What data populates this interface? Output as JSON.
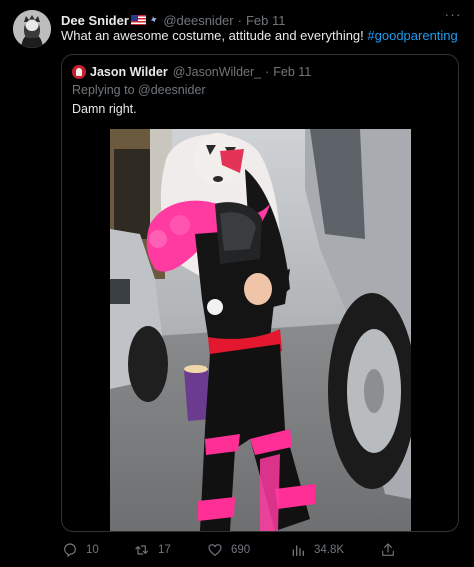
{
  "tweet": {
    "author_name": "Dee Snider",
    "author_handle": "@deesnider",
    "date": "Feb 11",
    "separator": "·",
    "text": "What an awesome costume, attitude and everything!",
    "hashtag": "#goodparenting",
    "more_label": "···"
  },
  "quote": {
    "author_name": "Jason Wilder",
    "author_handle": "@JasonWilder_",
    "date": "Feb 11",
    "separator": "·",
    "replying_to": "Replying to @deesnider",
    "text": "Damn right."
  },
  "actions": {
    "replies": "10",
    "retweets": "17",
    "likes": "690",
    "views": "34.8K"
  },
  "colors": {
    "background": "#000000",
    "text": "#e7e9ea",
    "muted": "#71767b",
    "link": "#1d9bf0",
    "border": "#2f3336"
  }
}
